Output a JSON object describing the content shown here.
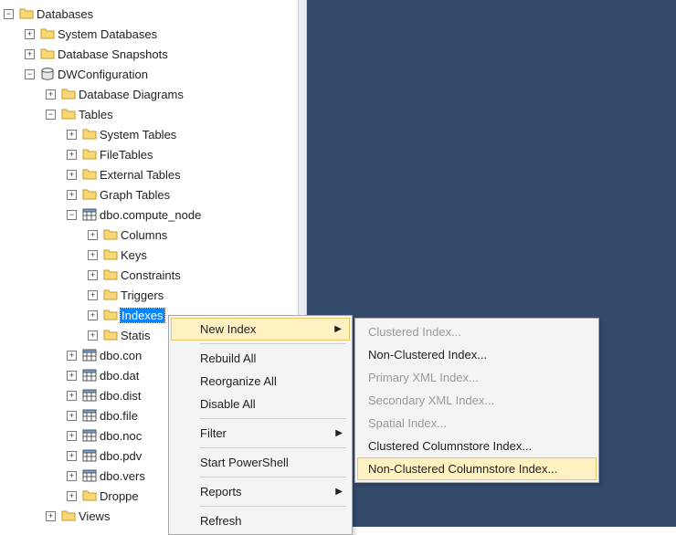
{
  "tree": {
    "databases": "Databases",
    "system_databases": "System Databases",
    "database_snapshots": "Database Snapshots",
    "dw_configuration": "DWConfiguration",
    "database_diagrams": "Database Diagrams",
    "tables": "Tables",
    "system_tables": "System Tables",
    "file_tables": "FileTables",
    "external_tables": "External Tables",
    "graph_tables": "Graph Tables",
    "compute_node": "dbo.compute_node",
    "columns": "Columns",
    "keys": "Keys",
    "constraints": "Constraints",
    "triggers": "Triggers",
    "indexes": "Indexes",
    "statistics": "Statis",
    "dbo_con": "dbo.con",
    "dbo_dat": "dbo.dat",
    "dbo_dist": "dbo.dist",
    "dbo_file": "dbo.file",
    "dbo_noc": "dbo.noc",
    "dbo_pdv": "dbo.pdv",
    "dbo_vers": "dbo.vers",
    "droppe": "Droppe",
    "views": "Views"
  },
  "menu": {
    "new_index": "New Index",
    "rebuild_all": "Rebuild All",
    "reorganize_all": "Reorganize All",
    "disable_all": "Disable All",
    "filter": "Filter",
    "start_powershell": "Start PowerShell",
    "reports": "Reports",
    "refresh": "Refresh"
  },
  "submenu": {
    "clustered": "Clustered Index...",
    "non_clustered": "Non-Clustered Index...",
    "primary_xml": "Primary XML Index...",
    "secondary_xml": "Secondary XML Index...",
    "spatial": "Spatial Index...",
    "clustered_cs": "Clustered Columnstore Index...",
    "non_clustered_cs": "Non-Clustered Columnstore Index..."
  }
}
